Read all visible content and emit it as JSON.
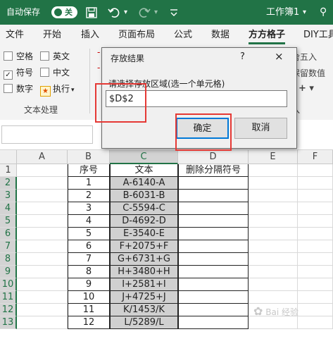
{
  "titlebar": {
    "autosave_label": "自动保存",
    "autosave_state": "关",
    "workbook_name": "工作簿1",
    "dropdown_glyph": "▾",
    "search_glyph": "⚲",
    "icons": [
      "save-icon",
      "undo-icon",
      "redo-icon",
      "customize-icon"
    ],
    "accent_color": "#217346"
  },
  "ribbon_tabs": [
    "文件",
    "开始",
    "插入",
    "页面布局",
    "公式",
    "数据",
    "方方格子",
    "DIY工具"
  ],
  "active_tab": "方方格子",
  "ribbon": {
    "checkboxes": [
      {
        "label": "空格",
        "checked": false
      },
      {
        "label": "英文",
        "checked": false
      },
      {
        "label": "符号",
        "checked": true
      },
      {
        "label": "中文",
        "checked": false
      },
      {
        "label": "数字",
        "checked": false
      }
    ],
    "execute_label": "执行",
    "execute_arrow": "▾",
    "group_label": "文本处理",
    "right_labels": [
      "舍五入",
      "保留数值",
      "入"
    ],
    "plus_label": "+ ▾",
    "dashes": [
      "-",
      "-",
      "-"
    ]
  },
  "dialog": {
    "title": "存放结果",
    "help": "?",
    "close": "×",
    "prompt": "请选择存放区域(选一个单元格)",
    "input_value": "$D$2",
    "ok_label": "确定",
    "cancel_label": "取消"
  },
  "grid": {
    "columns": [
      "A",
      "B",
      "C",
      "D",
      "E",
      "F"
    ],
    "selected_column": "C",
    "rows": [
      {
        "n": "1",
        "a": "",
        "b": "序号",
        "c": "文本",
        "d": "删除分隔符号"
      },
      {
        "n": "2",
        "a": "",
        "b": "1",
        "c": "A-6140-A",
        "d": ""
      },
      {
        "n": "3",
        "a": "",
        "b": "2",
        "c": "B-6031-B",
        "d": ""
      },
      {
        "n": "4",
        "a": "",
        "b": "3",
        "c": "C-5594-C",
        "d": ""
      },
      {
        "n": "5",
        "a": "",
        "b": "4",
        "c": "D-4692-D",
        "d": ""
      },
      {
        "n": "6",
        "a": "",
        "b": "5",
        "c": "E-3540-E",
        "d": ""
      },
      {
        "n": "7",
        "a": "",
        "b": "6",
        "c": "F+2075+F",
        "d": ""
      },
      {
        "n": "8",
        "a": "",
        "b": "7",
        "c": "G+6731+G",
        "d": ""
      },
      {
        "n": "9",
        "a": "",
        "b": "8",
        "c": "H+3480+H",
        "d": ""
      },
      {
        "n": "10",
        "a": "",
        "b": "9",
        "c": "I+2581+I",
        "d": ""
      },
      {
        "n": "11",
        "a": "",
        "b": "10",
        "c": "J+4725+J",
        "d": ""
      },
      {
        "n": "12",
        "a": "",
        "b": "11",
        "c": "K/1453/K",
        "d": ""
      },
      {
        "n": "13",
        "a": "",
        "b": "12",
        "c": "L/5289/L",
        "d": ""
      }
    ]
  },
  "watermark": "Bai 经验"
}
